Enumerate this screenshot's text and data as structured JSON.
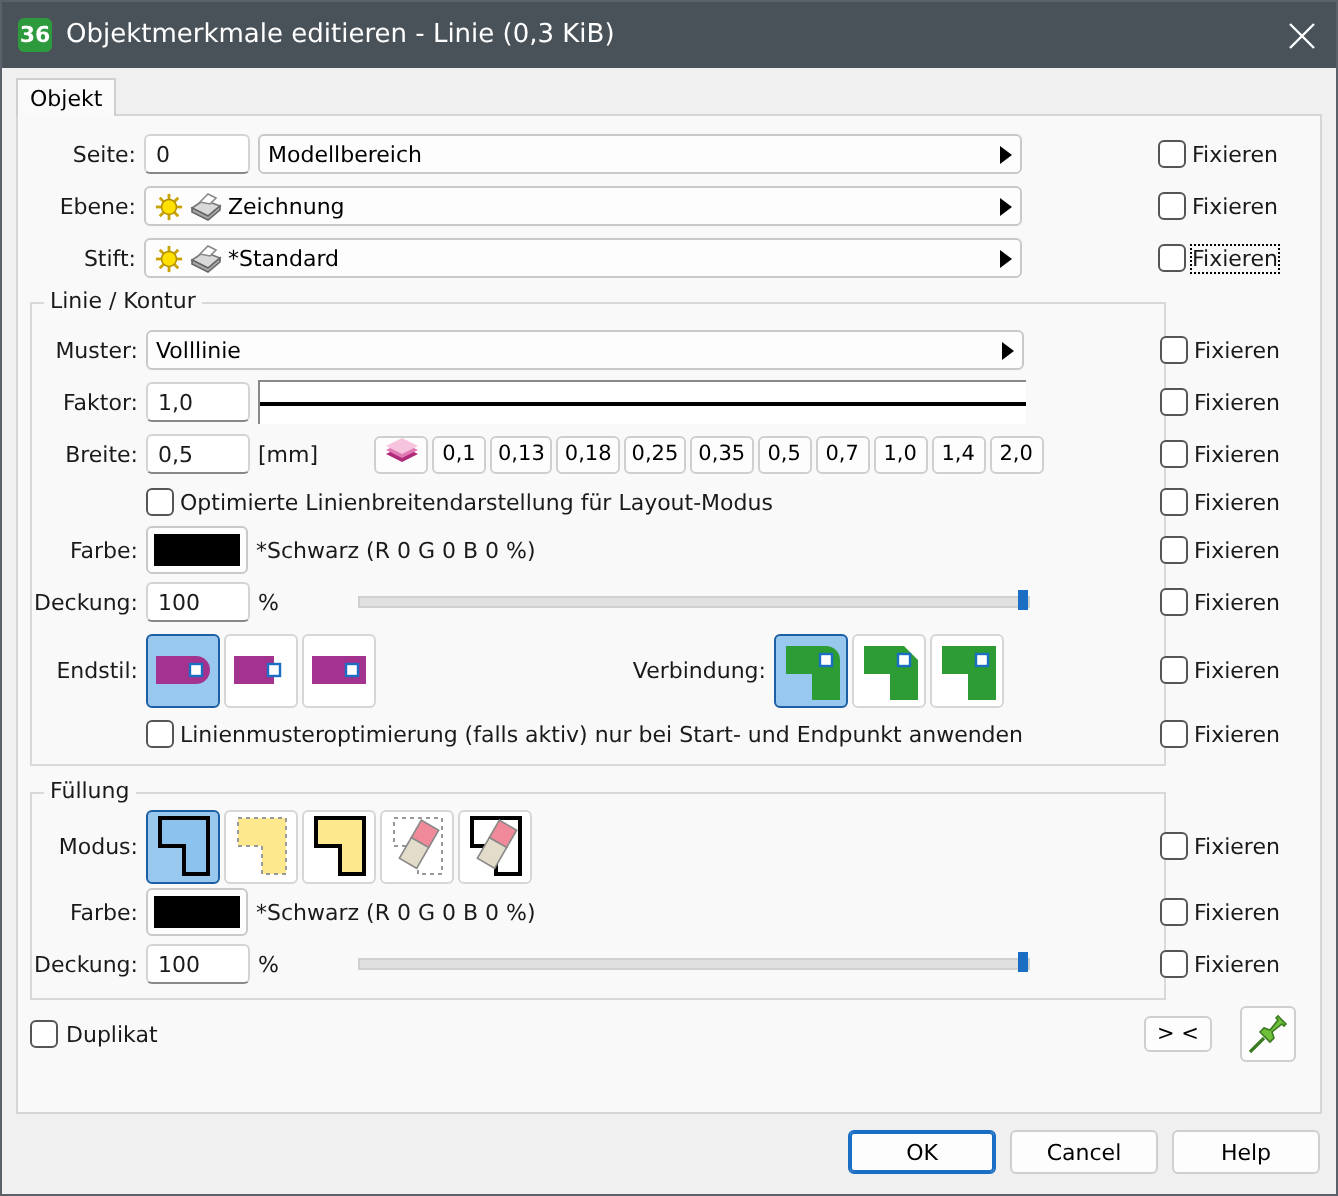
{
  "window": {
    "app_icon": "36",
    "title": "Objektmerkmale editieren - Linie (0,3 KiB)"
  },
  "tabs": [
    {
      "label": "Objekt",
      "selected": true
    }
  ],
  "top_rows": [
    {
      "kind": "page",
      "label": "Seite:",
      "number": "0",
      "value": "Modellbereich",
      "fix": {
        "label": "Fixieren",
        "checked": false,
        "focused": false
      }
    },
    {
      "kind": "layer",
      "label": "Ebene:",
      "value": "Zeichnung",
      "fix": {
        "label": "Fixieren",
        "checked": false,
        "focused": false
      }
    },
    {
      "kind": "layer",
      "label": "Stift:",
      "value": "*Standard",
      "fix": {
        "label": "Fixieren",
        "checked": false,
        "focused": true
      }
    }
  ],
  "line_group": {
    "title": "Linie / Kontur",
    "pattern": {
      "label": "Muster:",
      "value": "Volllinie",
      "fix": {
        "label": "Fixieren",
        "checked": false,
        "focused": false
      }
    },
    "factor": {
      "label": "Faktor:",
      "value": "1,0",
      "fix": {
        "label": "Fixieren",
        "checked": false,
        "focused": false
      }
    },
    "width": {
      "label": "Breite:",
      "value": "0,5",
      "unit": "[mm]",
      "presets": [
        "0,1",
        "0,13",
        "0,18",
        "0,25",
        "0,35",
        "0,5",
        "0,7",
        "1,0",
        "1,4",
        "2,0"
      ],
      "fix": {
        "label": "Fixieren",
        "checked": false,
        "focused": false
      }
    },
    "optimize": {
      "label": "Optimierte Linienbreitendarstellung für Layout-Modus",
      "checked": false,
      "fix": {
        "label": "Fixieren",
        "checked": false,
        "focused": false
      }
    },
    "color": {
      "label": "Farbe:",
      "color": "#000000",
      "name": "*Schwarz (R 0 G 0 B 0 %)",
      "fix": {
        "label": "Fixieren",
        "checked": false,
        "focused": false
      }
    },
    "opacity": {
      "label": "Deckung:",
      "value": "100",
      "unit": "%",
      "level": 1,
      "fix": {
        "label": "Fixieren",
        "checked": false,
        "focused": false
      }
    },
    "end_style": {
      "label": "Endstil:",
      "options": [
        {
          "kind": "round",
          "selected": true
        },
        {
          "kind": "flat",
          "selected": false
        },
        {
          "kind": "square",
          "selected": false
        }
      ]
    },
    "join": {
      "label": "Verbindung:",
      "options": [
        {
          "kind": "round",
          "selected": true
        },
        {
          "kind": "bevel",
          "selected": false
        },
        {
          "kind": "miter",
          "selected": false
        }
      ],
      "fix": {
        "label": "Fixieren",
        "checked": false,
        "focused": false
      }
    },
    "pattern_opt": {
      "label": "Linienmusteroptimierung (falls aktiv) nur bei Start- und Endpunkt anwenden",
      "checked": false,
      "fix": {
        "label": "Fixieren",
        "checked": false,
        "focused": false
      }
    }
  },
  "fill_group": {
    "title": "Füllung",
    "mode": {
      "label": "Modus:",
      "options": [
        {
          "kind": "solid",
          "selected": true
        },
        {
          "kind": "fill-dashed",
          "selected": false
        },
        {
          "kind": "fill-outline",
          "selected": false
        },
        {
          "kind": "erase-dashed",
          "selected": false
        },
        {
          "kind": "erase-outline",
          "selected": false
        }
      ],
      "fix": {
        "label": "Fixieren",
        "checked": false,
        "focused": false
      }
    },
    "color": {
      "label": "Farbe:",
      "color": "#000000",
      "name": "*Schwarz (R 0 G 0 B 0 %)",
      "fix": {
        "label": "Fixieren",
        "checked": false,
        "focused": false
      }
    },
    "opacity": {
      "label": "Deckung:",
      "value": "100",
      "unit": "%",
      "level": 1,
      "fix": {
        "label": "Fixieren",
        "checked": false,
        "focused": false
      }
    }
  },
  "duplicate": {
    "label": "Duplikat",
    "checked": false
  },
  "compare_button": "> <",
  "buttons": [
    {
      "label": "OK",
      "default": true
    },
    {
      "label": "Cancel",
      "default": false
    },
    {
      "label": "Help",
      "default": false
    }
  ]
}
